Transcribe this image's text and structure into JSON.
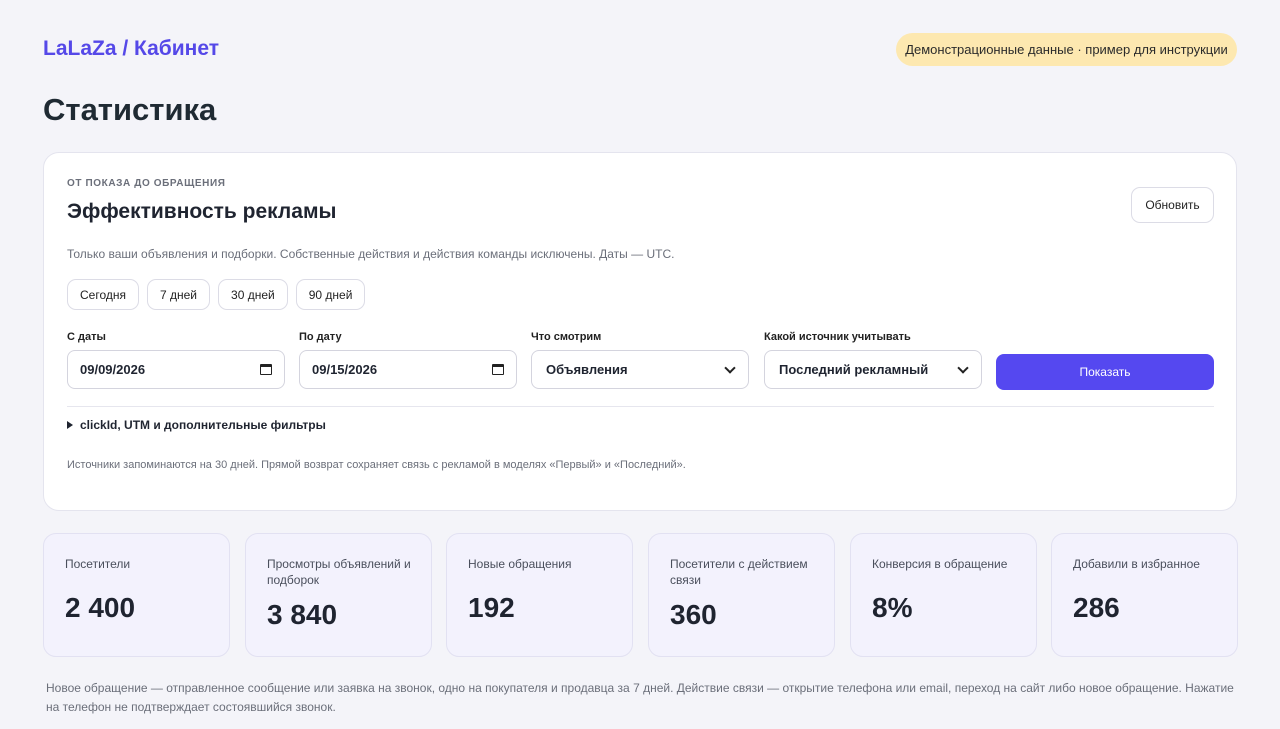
{
  "header": {
    "logo": "LaLaZa / Кабинет",
    "demo_badge": "Демонстрационные данные · пример для инструкции",
    "page_title": "Статистика"
  },
  "card": {
    "eyebrow": "ОТ ПОКАЗА ДО ОБРАЩЕНИЯ",
    "title": "Эффективность рекламы",
    "refresh_label": "Обновить",
    "hint": "Только ваши объявления и подборки. Собственные действия и действия команды исключены. Даты — UTC.",
    "presets": [
      "Сегодня",
      "7 дней",
      "30 дней",
      "90 дней"
    ],
    "date_from": {
      "label": "С даты",
      "value": "09/09/2026"
    },
    "date_to": {
      "label": "По дату",
      "value": "09/15/2026"
    },
    "what": {
      "label": "Что смотрим",
      "value": "Объявления"
    },
    "source": {
      "label": "Какой источник учитывать",
      "value": "Последний рекламный"
    },
    "show_label": "Показать",
    "advanced_label": "clickId, UTM и дополнительные фильтры",
    "note": "Источники запоминаются на 30 дней. Прямой возврат сохраняет связь с рекламой в моделях «Первый» и «Последний»."
  },
  "metrics": [
    {
      "label": "Посетители",
      "value": "2 400"
    },
    {
      "label": "Просмотры объявлений и подборок",
      "value": "3 840"
    },
    {
      "label": "Новые обращения",
      "value": "192"
    },
    {
      "label": "Посетители с действием связи",
      "value": "360"
    },
    {
      "label": "Конверсия в обращение",
      "value": "8%"
    },
    {
      "label": "Добавили в избранное",
      "value": "286"
    }
  ],
  "footer": "Новое обращение — отправленное сообщение или заявка на звонок, одно на покупателя и продавца за 7 дней. Действие связи — открытие телефона или email, переход на сайт либо новое обращение. Нажатие на телефон не подтверждает состоявшийся звонок.",
  "colors": {
    "accent": "#5548f0",
    "badge": "#fde8b0",
    "metric_bg": "#f3f2fd"
  }
}
